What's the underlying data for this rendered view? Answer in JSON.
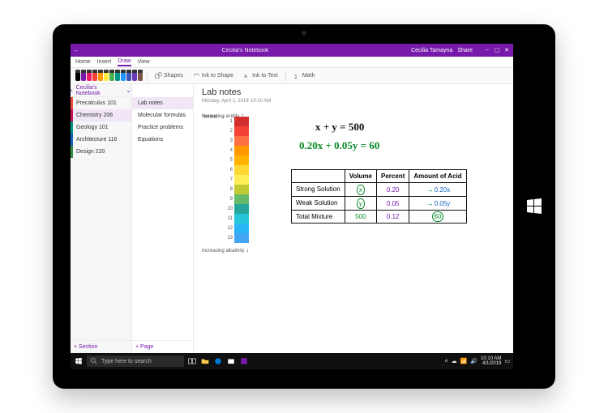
{
  "titlebar": {
    "back": "←",
    "appname": "Cecilia's Notebook",
    "user": "Cecilia Tamayna",
    "min": "–",
    "max": "▢",
    "close": "✕"
  },
  "ribbon": {
    "tabs": [
      "Home",
      "Insert",
      "Draw",
      "View"
    ],
    "active": 2
  },
  "toolbar": {
    "pens": [
      "#000",
      "#7719aa",
      "#e91e63",
      "#f44336",
      "#ff9800",
      "#ffeb3b",
      "#4caf50",
      "#009688",
      "#2196f3",
      "#3f51b5",
      "#673ab7",
      "#795548"
    ],
    "shapes": "Shapes",
    "inktoshape": "Ink to Shape",
    "inktotext": "Ink to Text",
    "math": "Math"
  },
  "nav": {
    "header": "Cecilia's Notebook",
    "sections": [
      {
        "label": "Precalculus 101",
        "cls": "s-red"
      },
      {
        "label": "Chemistry 206",
        "cls": "s-mag",
        "sel": true
      },
      {
        "label": "Geology 101",
        "cls": "s-teal"
      },
      {
        "label": "Architecture 116",
        "cls": "s-blue"
      },
      {
        "label": "Design 220",
        "cls": "s-grn"
      }
    ],
    "pages": [
      {
        "label": "Lab notes",
        "sel": true
      },
      {
        "label": "Molecular formulas"
      },
      {
        "label": "Practice problems"
      },
      {
        "label": "Equations"
      }
    ],
    "addsection": "+  Section",
    "addpage": "+  Page"
  },
  "page": {
    "title": "Lab notes",
    "date": "Monday, April 1, 2019",
    "time": "10:10 AM"
  },
  "scale": {
    "top": "Increasing acidity",
    "mid": "Neutral",
    "bot": "Increasing alkalinity",
    "ticks": [
      "1",
      "2",
      "3",
      "4",
      "5",
      "6",
      "7",
      "8",
      "9",
      "10",
      "11",
      "12",
      "13"
    ],
    "colors": [
      "#d32f2f",
      "#f44336",
      "#ff7043",
      "#ff9800",
      "#ffb300",
      "#fdd835",
      "#ffee58",
      "#c0ca33",
      "#66bb6a",
      "#26a69a",
      "#26c6da",
      "#29b6f6",
      "#42a5f5"
    ]
  },
  "equations": {
    "line1": "x + y = 500",
    "line2": "0.20x + 0.05y = 60"
  },
  "table": {
    "headers": [
      "",
      "Volume",
      "Percent",
      "Amount of Acid"
    ],
    "rows": [
      {
        "label": "Strong Solution",
        "vol": "x",
        "pct": "0.20",
        "amt": "0.20x"
      },
      {
        "label": "Weak Solution",
        "vol": "y",
        "pct": "0.05",
        "amt": "0.05y"
      },
      {
        "label": "Total Mixture",
        "vol": "500",
        "pct": "0.12",
        "amt": "60"
      }
    ]
  },
  "taskbar": {
    "search": "Type here to search",
    "time": "10:10 AM",
    "date": "4/1/2019"
  },
  "share": {
    "share": "Share"
  }
}
